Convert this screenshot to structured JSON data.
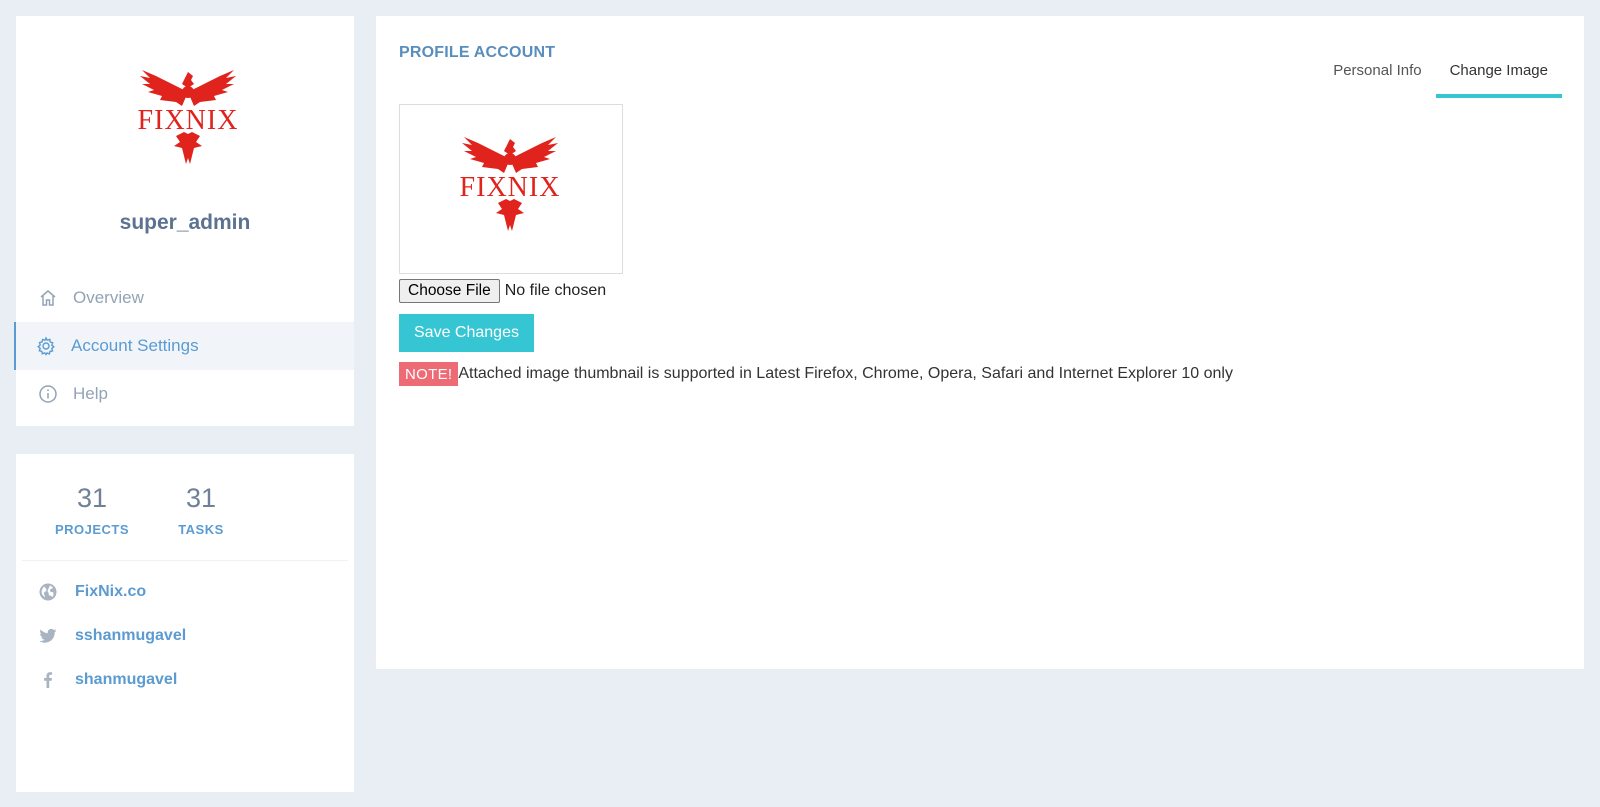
{
  "profile": {
    "username": "super_admin",
    "logo_text": "FIXNIX"
  },
  "sidebar": {
    "items": [
      {
        "label": "Overview",
        "icon": "home-icon",
        "active": false
      },
      {
        "label": "Account Settings",
        "icon": "gear-icon",
        "active": true
      },
      {
        "label": "Help",
        "icon": "info-icon",
        "active": false
      }
    ]
  },
  "stats": {
    "projects": {
      "value": "31",
      "label": "PROJECTS"
    },
    "tasks": {
      "value": "31",
      "label": "TASKS"
    }
  },
  "links": [
    {
      "label": "FixNix.co",
      "icon": "globe-icon"
    },
    {
      "label": "sshanmugavel",
      "icon": "twitter-icon"
    },
    {
      "label": "shanmugavel",
      "icon": "facebook-icon"
    }
  ],
  "main": {
    "title": "PROFILE ACCOUNT",
    "tabs": [
      {
        "label": "Personal Info",
        "active": false
      },
      {
        "label": "Change Image",
        "active": true
      }
    ],
    "file_button_label": "Choose File",
    "file_status": "No file chosen",
    "save_label": "Save Changes",
    "note_badge": "NOTE!",
    "note_text": "Attached image thumbnail is supported in Latest Firefox, Chrome, Opera, Safari and Internet Explorer 10 only"
  },
  "colors": {
    "accent": "#36c6d3",
    "link": "#5b9bd1",
    "title": "#578ebe",
    "note": "#ed6b75",
    "logo_red": "#e0231c",
    "background": "#e9edf4"
  }
}
